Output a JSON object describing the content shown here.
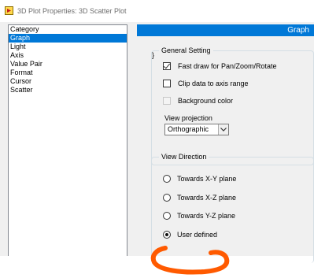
{
  "window": {
    "title": "3D Plot Properties: 3D Scatter Plot",
    "icon": "labview-app-icon",
    "accent_color": "#0078d7"
  },
  "category": {
    "header": "Category",
    "items": [
      "Graph",
      "Light",
      "Axis",
      "Value Pair",
      "Format",
      "Cursor",
      "Scatter"
    ],
    "selected": "Graph"
  },
  "page": {
    "title": "Graph"
  },
  "general_setting": {
    "title": "General Setting",
    "fast_draw": {
      "label": "Fast draw for Pan/Zoom/Rotate",
      "checked": true
    },
    "clip_data": {
      "label": "Clip data to axis range",
      "checked": false
    },
    "background_color": {
      "label": "Background color",
      "checked": false,
      "enabled": false
    },
    "view_projection": {
      "label": "View projection",
      "value": "Orthographic"
    }
  },
  "view_direction": {
    "title": "View Direction",
    "options": [
      "Towards X-Y plane",
      "Towards X-Z plane",
      "Towards Y-Z plane",
      "User defined"
    ],
    "selected": "User defined"
  },
  "annotation": {
    "color": "#ff5a00",
    "shape": "hand-drawn underline"
  }
}
